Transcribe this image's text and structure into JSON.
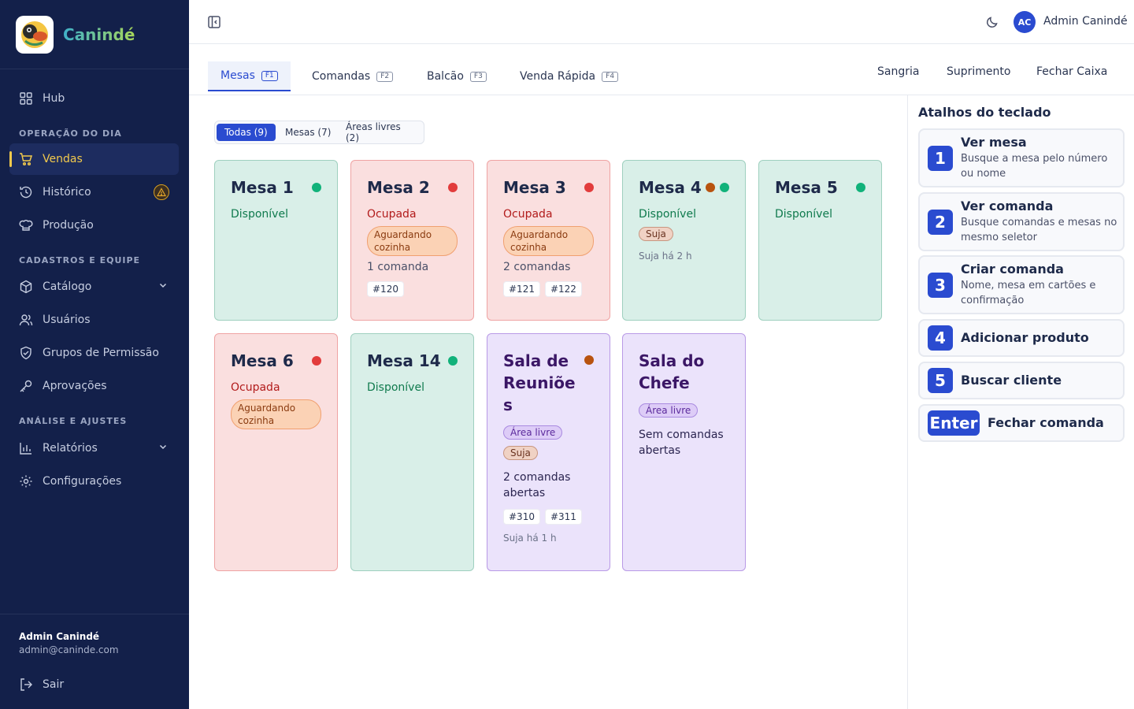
{
  "brand": {
    "name": "Canindé"
  },
  "sidebar": {
    "hub": "Hub",
    "section_day": "OPERAÇÃO DO DIA",
    "vendas": "Vendas",
    "historico": "Histórico",
    "producao": "Produção",
    "section_team": "CADASTROS E EQUIPE",
    "catalogo": "Catálogo",
    "usuarios": "Usuários",
    "grupos": "Grupos de Permissão",
    "aprovacoes": "Aprovações",
    "section_analysis": "ANÁLISE E AJUSTES",
    "relatorios": "Relatórios",
    "configuracoes": "Configurações",
    "user_name": "Admin Canindé",
    "user_email": "admin@caninde.com",
    "logout": "Sair"
  },
  "topbar": {
    "avatar_initials": "AC",
    "user": "Admin Canindé"
  },
  "tabs": [
    {
      "label": "Mesas",
      "key": "F1"
    },
    {
      "label": "Comandas",
      "key": "F2"
    },
    {
      "label": "Balcão",
      "key": "F3"
    },
    {
      "label": "Venda Rápida",
      "key": "F4"
    }
  ],
  "actions": {
    "sangria": "Sangria",
    "suprimento": "Suprimento",
    "fechar": "Fechar Caixa"
  },
  "filters": {
    "todas": "Todas (9)",
    "mesas": "Mesas (7)",
    "areas": "Áreas livres (2)"
  },
  "cards": {
    "m1": {
      "title": "Mesa 1",
      "status": "Disponível"
    },
    "m2": {
      "title": "Mesa 2",
      "status": "Ocupada",
      "pill": "Aguardando cozinha",
      "count": "1 comanda",
      "chip1": "#120"
    },
    "m3": {
      "title": "Mesa 3",
      "status": "Ocupada",
      "pill": "Aguardando cozinha",
      "count": "2 comandas",
      "chip1": "#121",
      "chip2": "#122"
    },
    "m4": {
      "title": "Mesa 4",
      "status": "Disponível",
      "pill": "Suja",
      "meta": "Suja há 2 h"
    },
    "m5": {
      "title": "Mesa 5",
      "status": "Disponível"
    },
    "m6": {
      "title": "Mesa 6",
      "status": "Ocupada",
      "pill": "Aguardando cozinha"
    },
    "m14": {
      "title": "Mesa 14",
      "status": "Disponível"
    },
    "sr": {
      "title": "Sala de Reuniõe s",
      "pill_area": "Área livre",
      "pill_suja": "Suja",
      "text": "2 comandas abertas",
      "chip1": "#310",
      "chip2": "#311",
      "meta": "Suja há 1 h"
    },
    "sc": {
      "title": "Sala do Chefe",
      "pill_area": "Área livre",
      "text": "Sem comandas abertas"
    }
  },
  "shortcuts": {
    "title": "Atalhos do teclado",
    "items": [
      {
        "key": "1",
        "name": "Ver mesa",
        "desc": "Busque a mesa pelo número ou nome"
      },
      {
        "key": "2",
        "name": "Ver comanda",
        "desc": "Busque comandas e mesas no mesmo seletor"
      },
      {
        "key": "3",
        "name": "Criar comanda",
        "desc": "Nome, mesa em cartões e confirmação"
      },
      {
        "key": "4",
        "name": "Adicionar produto"
      },
      {
        "key": "5",
        "name": "Buscar cliente"
      },
      {
        "key": "Enter",
        "name": "Fechar comanda"
      }
    ]
  },
  "colors": {
    "sidebar_bg": "#13204a",
    "accent": "#2a4bd0",
    "active_nav": "#f2c94c",
    "free": "#11b27a",
    "busy": "#e23c3c",
    "dirty": "#b8530f"
  }
}
